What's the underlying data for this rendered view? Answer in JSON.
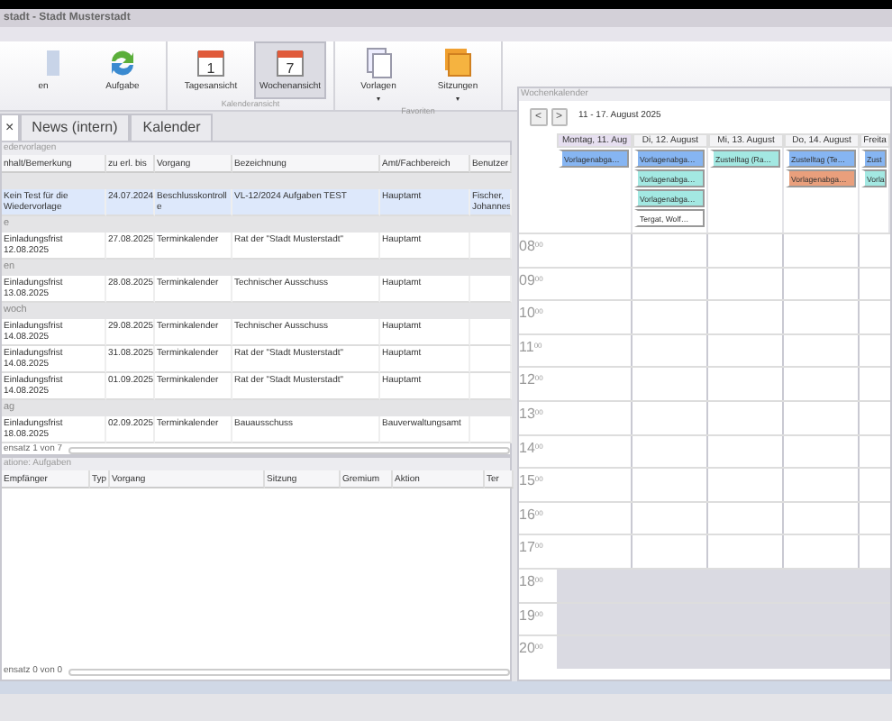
{
  "window": {
    "title": "stadt - Stadt Musterstadt"
  },
  "ribbon": {
    "groups": [
      {
        "buttons": [
          {
            "label": "en",
            "kind": "person",
            "selected": false
          },
          {
            "label": "Aufgabe",
            "kind": "refresh",
            "selected": false
          }
        ]
      },
      {
        "label": "Kalenderansicht",
        "buttons": [
          {
            "label": "Tagesansicht",
            "kind": "calendar",
            "glyph": "1",
            "selected": false
          },
          {
            "label": "Wochenansicht",
            "kind": "calendar",
            "glyph": "7",
            "selected": true
          }
        ]
      },
      {
        "label": "Favoriten",
        "buttons": [
          {
            "label": "Vorlagen",
            "kind": "documents",
            "selected": false,
            "caret": "▾"
          },
          {
            "label": "Sitzungen",
            "kind": "stack",
            "selected": false,
            "caret": "▾"
          }
        ]
      }
    ]
  },
  "tabs": [
    {
      "close": "×",
      "selected": true
    },
    {
      "label": "News (intern)",
      "selected": false
    },
    {
      "label": "Kalender",
      "selected": false
    }
  ],
  "grid": {
    "title": "edervorlagen",
    "columns": [
      "nhalt/Bemerkung",
      "zu erl. bis",
      "Vorgang",
      "Bezeichnung",
      "Amt/Fachbereich",
      "Benutzer"
    ],
    "groups": [
      {
        "rows": [
          {
            "selected": true,
            "cells": [
              "Kein Test für die Wiedervorlage",
              "24.07.2024",
              "Beschlusskontroll e",
              "VL-12/2024 Aufgaben TEST",
              "Hauptamt",
              "Fischer, Johannes"
            ]
          }
        ]
      },
      {
        "label": "e",
        "rows": [
          {
            "selected": false,
            "cells": [
              "Einladungsfrist 12.08.2025",
              "27.08.2025",
              "Terminkalender",
              "Rat der \"Stadt Musterstadt\"",
              "Hauptamt"
            ]
          }
        ]
      },
      {
        "label": "en",
        "rows": [
          {
            "selected": false,
            "cells": [
              "Einladungsfrist 13.08.2025",
              "28.08.2025",
              "Terminkalender",
              "Technischer Ausschuss",
              "Hauptamt"
            ]
          }
        ]
      },
      {
        "label": "woch",
        "rows": [
          {
            "selected": false,
            "cells": [
              "Einladungsfrist 14.08.2025",
              "29.08.2025",
              "Terminkalender",
              "Technischer Ausschuss",
              "Hauptamt"
            ]
          },
          {
            "selected": false,
            "cells": [
              "Einladungsfrist 14.08.2025",
              "31.08.2025",
              "Terminkalender",
              "Rat der \"Stadt Musterstadt\"",
              "Hauptamt"
            ]
          },
          {
            "selected": false,
            "cells": [
              "Einladungsfrist 14.08.2025",
              "01.09.2025",
              "Terminkalender",
              "Rat der \"Stadt Musterstadt\"",
              "Hauptamt"
            ]
          }
        ]
      },
      {
        "label": "ag",
        "rows": [
          {
            "selected": false,
            "cells": [
              "Einladungsfrist 18.08.2025",
              "02.09.2025",
              "Terminkalender",
              "Bauausschuss",
              "Bauverwaltungsamt"
            ]
          }
        ]
      }
    ],
    "pager": "ensatz 1 von 7"
  },
  "tasks": {
    "title": "atione: Aufgaben",
    "columns": [
      "Empfänger",
      "Typ",
      "Vorgang",
      "Sitzung",
      "Gremium",
      "Aktion",
      "Ter"
    ],
    "pager": "ensatz 0 von 0"
  },
  "calendar": {
    "title": "Wochenkalender",
    "prev": "<",
    "next": ">",
    "range": "11 - 17. August 2025",
    "days": [
      {
        "label": "Montag, 11. Aug",
        "selected": true,
        "events": [
          {
            "text": "Vorlagenabga…",
            "color": "#86b5f2"
          }
        ]
      },
      {
        "label": "Di, 12. August",
        "selected": false,
        "events": [
          {
            "text": "Vorlagenabga…",
            "color": "#86b5f2"
          },
          {
            "text": "Vorlagenabga…",
            "color": "#a3e8e2"
          },
          {
            "text": "Vorlagenabga…",
            "color": "#a3e8e2"
          },
          {
            "text": "Tergat, Wolf…",
            "color": "#ffffff"
          }
        ]
      },
      {
        "label": "Mi, 13. August",
        "selected": false,
        "events": [
          {
            "text": "Zustelltag (Ra…",
            "color": "#a3e8e2"
          }
        ]
      },
      {
        "label": "Do, 14. August",
        "selected": false,
        "events": [
          {
            "text": "Zustelltag (Te…",
            "color": "#86b5f2"
          },
          {
            "text": "Vorlagenabga…",
            "color": "#e99f7c"
          }
        ]
      },
      {
        "label": "Freita",
        "selected": false,
        "events": [
          {
            "text": "Zust",
            "color": "#86b5f2"
          },
          {
            "text": "Vorla",
            "color": "#a3e8e2"
          }
        ]
      }
    ],
    "hours": [
      {
        "label": "08$^{00}$",
        "off": false
      },
      {
        "label": "09$^{00}$",
        "off": false
      },
      {
        "label": "10$^{00}$",
        "off": false
      },
      {
        "label": "11$^{00}$",
        "off": false
      },
      {
        "label": "12$^{00}$",
        "off": false
      },
      {
        "label": "13$^{00}$",
        "off": false
      },
      {
        "label": "14$^{00}$",
        "off": false
      },
      {
        "label": "15$^{00}$",
        "off": false
      },
      {
        "label": "16$^{00}$",
        "off": false
      },
      {
        "label": "17$^{00}$",
        "off": false
      },
      {
        "label": "18$^{00}$",
        "off": true
      },
      {
        "label": "19$^{00}$",
        "off": true
      },
      {
        "label": "20$^{00}$",
        "off": true
      }
    ]
  }
}
